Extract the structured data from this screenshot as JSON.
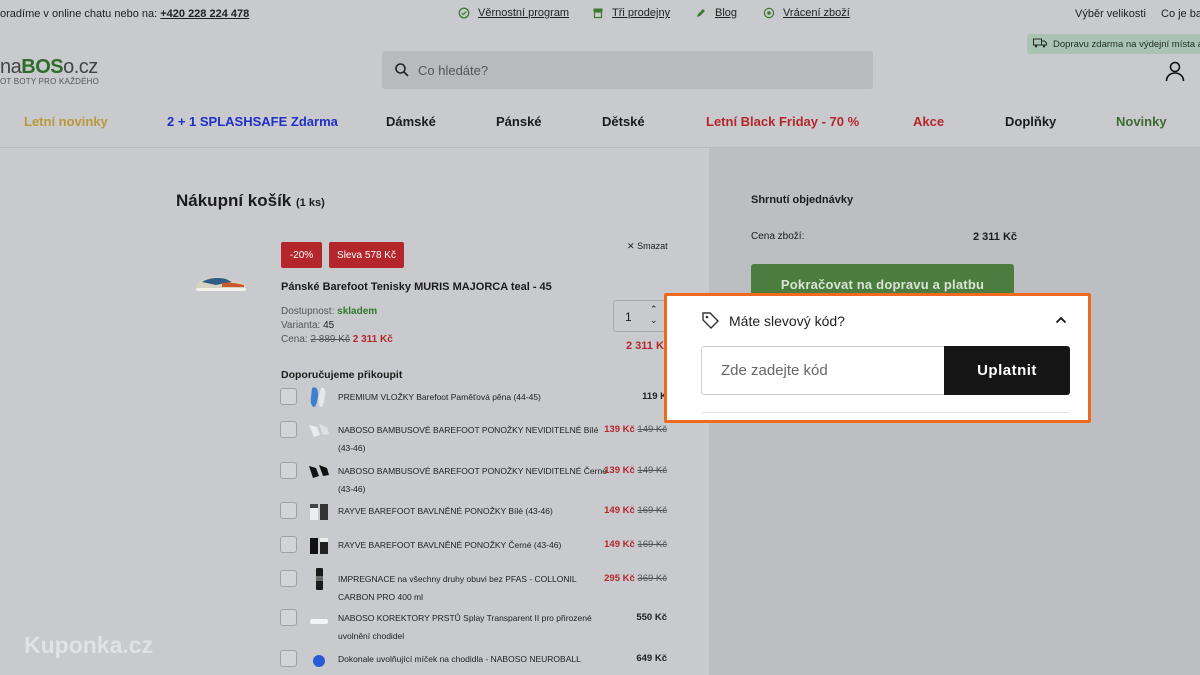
{
  "topbar": {
    "contact_text": "oradíme v online chatu nebo na:",
    "phone": "+420 228 224 478",
    "links": [
      {
        "label": "Věrnostní program",
        "icon": "loyalty-icon"
      },
      {
        "label": "Tři prodejny",
        "icon": "store-icon"
      },
      {
        "label": "Blog",
        "icon": "pencil-icon"
      },
      {
        "label": "Vrácení zboží",
        "icon": "return-icon"
      }
    ],
    "size_guide": "Výběr velikosti",
    "about": "Co je bar"
  },
  "header": {
    "logo_prefix": "na",
    "logo_accent": "BOS",
    "logo_suffix": "o.cz",
    "logo_tagline": "OT BOTY PRO KAŽDÉHO",
    "search_placeholder": "Co hledáte?",
    "promo_text": "Dopravu zdarma na výdejní místa a d"
  },
  "nav": [
    {
      "label": "Letní novinky",
      "color": "#b99a3a"
    },
    {
      "label": "2 + 1 SPLASHSAFE Zdarma",
      "color": "#1f2fc8"
    },
    {
      "label": "Dámské",
      "color": "#1c1c1c"
    },
    {
      "label": "Pánské",
      "color": "#1c1c1c"
    },
    {
      "label": "Dětské",
      "color": "#1c1c1c"
    },
    {
      "label": "Letní Black Friday - 70 %",
      "color": "#b3272c"
    },
    {
      "label": "Akce",
      "color": "#b3272c"
    },
    {
      "label": "Doplňky",
      "color": "#1c1c1c"
    },
    {
      "label": "Novinky",
      "color": "#3d6b31"
    }
  ],
  "cart": {
    "title": "Nákupní košík",
    "count": "(1 ks)",
    "item": {
      "discount_badge": "-20%",
      "savings_badge": "Sleva 578 Kč",
      "delete": "Smazat",
      "name": "Pánské Barefoot Tenisky MURIS MAJORCA teal - 45",
      "availability_label": "Dostupnost:",
      "availability_value": "skladem",
      "variant_label": "Varianta:",
      "variant_value": "45",
      "price_label": "Cena:",
      "old_price": "2 889 Kč",
      "new_price": "2 311 Kč",
      "quantity": "1",
      "line_total": "2 311 Kč"
    },
    "recommend_title": "Doporučujeme přikoupit",
    "recommendations": [
      {
        "name": "PREMIUM VLOŽKY Barefoot Paměťová pěna (44-45)",
        "price": "119 K",
        "old": ""
      },
      {
        "name": "NABOSO BAMBUSOVÉ BAREFOOT PONOŽKY NEVIDITELNÉ Bílé (43-46)",
        "price": "139 Kč",
        "old": "149 Kč"
      },
      {
        "name": "NABOSO BAMBUSOVÉ BAREFOOT PONOŽKY NEVIDITELNÉ Černé (43-46)",
        "price": "139 Kč",
        "old": "149 Kč"
      },
      {
        "name": "RAYVE BAREFOOT BAVLNĚNÉ PONOŽKY Bílé (43-46)",
        "price": "149 Kč",
        "old": "169 Kč"
      },
      {
        "name": "RAYVE BAREFOOT BAVLNĚNÉ PONOŽKY Černé (43-46)",
        "price": "149 Kč",
        "old": "169 Kč"
      },
      {
        "name": "IMPREGNACE na všechny druhy obuvi bez PFAS - COLLONIL CARBON PRO 400 ml",
        "price": "295 Kč",
        "old": "369 Kč"
      },
      {
        "name": "NABOSO KOREKTORY PRSTŮ Splay Transparent II pro přirozené uvolnění chodidel",
        "price": "550 Kč",
        "old": ""
      },
      {
        "name": "Dokonale uvolňující míček na chodidla - NABOSO NEUROBALL",
        "price": "649 Kč",
        "old": ""
      }
    ]
  },
  "summary": {
    "title": "Shrnutí objednávky",
    "goods_label": "Cena zboží:",
    "goods_value": "2 311 Kč",
    "continue_button": "Pokračovat na dopravu a platbu"
  },
  "coupon": {
    "title": "Máte slevový kód?",
    "input_placeholder": "Zde zadejte kód",
    "apply_button": "Uplatnit",
    "border_color": "#ef6a1f"
  },
  "watermark": "Kuponka.cz"
}
